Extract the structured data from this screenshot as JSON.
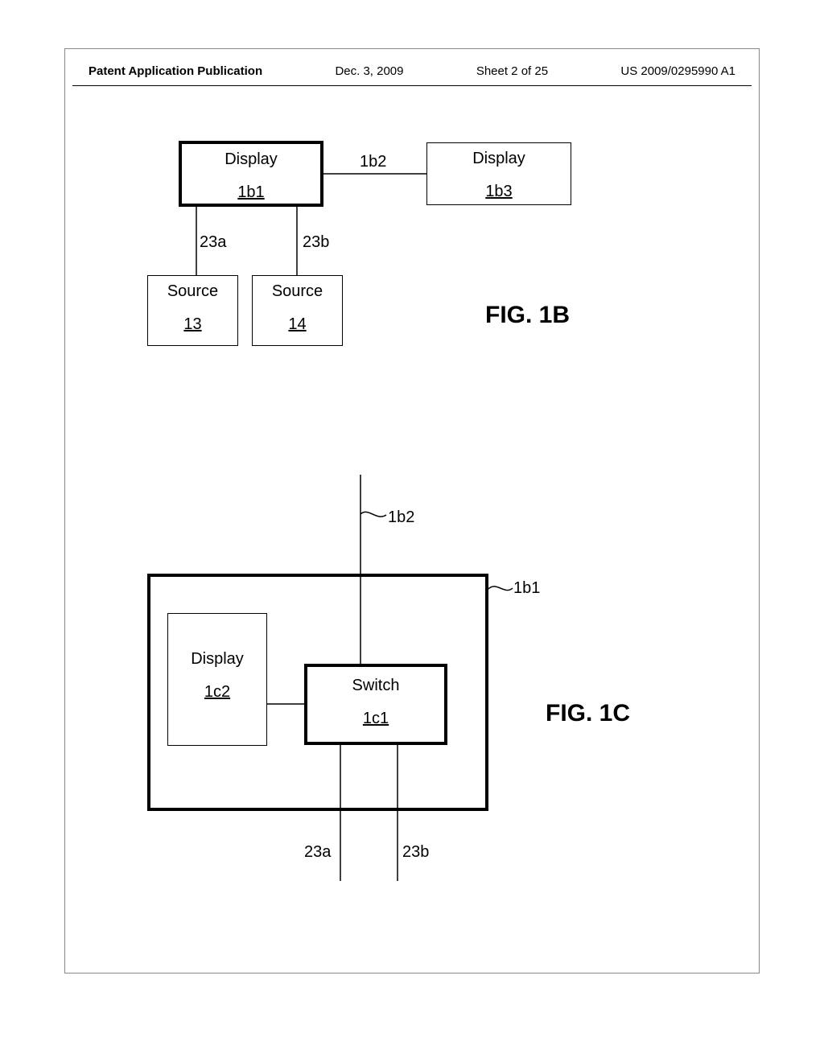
{
  "header": {
    "pub": "Patent Application Publication",
    "date": "Dec. 3, 2009",
    "sheet": "Sheet 2 of 25",
    "docnum": "US 2009/0295990 A1"
  },
  "fig1b": {
    "display1": {
      "label": "Display",
      "ref": "1b1"
    },
    "display2": {
      "label": "Display",
      "ref": "1b3"
    },
    "source1": {
      "label": "Source",
      "ref": "13"
    },
    "source2": {
      "label": "Source",
      "ref": "14"
    },
    "conn_1b2": "1b2",
    "conn_23a": "23a",
    "conn_23b": "23b",
    "caption": "FIG. 1B"
  },
  "fig1c": {
    "outer_ref": "1b1",
    "top_conn": "1b2",
    "display": {
      "label": "Display",
      "ref": "1c2"
    },
    "switch": {
      "label": "Switch",
      "ref": "1c1"
    },
    "conn_23a": "23a",
    "conn_23b": "23b",
    "caption": "FIG. 1C"
  }
}
